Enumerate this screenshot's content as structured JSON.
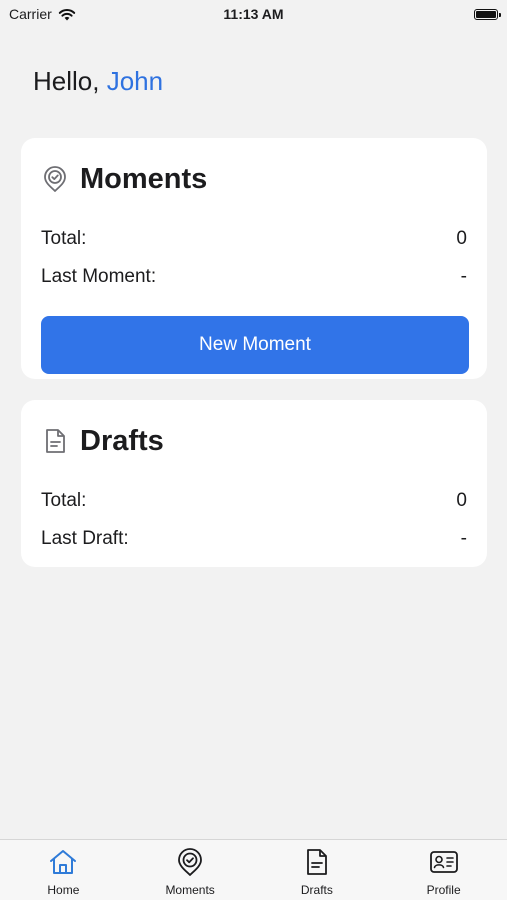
{
  "status_bar": {
    "carrier": "Carrier",
    "time": "11:13 AM"
  },
  "greeting": {
    "prefix": "Hello,",
    "name": "John"
  },
  "moments_card": {
    "title": "Moments",
    "total_label": "Total:",
    "total_value": "0",
    "last_label": "Last Moment:",
    "last_value": "-",
    "button_label": "New Moment"
  },
  "drafts_card": {
    "title": "Drafts",
    "total_label": "Total:",
    "total_value": "0",
    "last_label": "Last Draft:",
    "last_value": "-"
  },
  "tab_bar": {
    "tabs": [
      {
        "label": "Home",
        "icon": "home-icon",
        "active": true
      },
      {
        "label": "Moments",
        "icon": "location-check-icon",
        "active": false
      },
      {
        "label": "Drafts",
        "icon": "document-icon",
        "active": false
      },
      {
        "label": "Profile",
        "icon": "id-card-icon",
        "active": false
      }
    ]
  },
  "colors": {
    "accent": "#3174e8",
    "name_color": "#2f72e0",
    "background": "#f2f2f2",
    "card": "#ffffff"
  }
}
